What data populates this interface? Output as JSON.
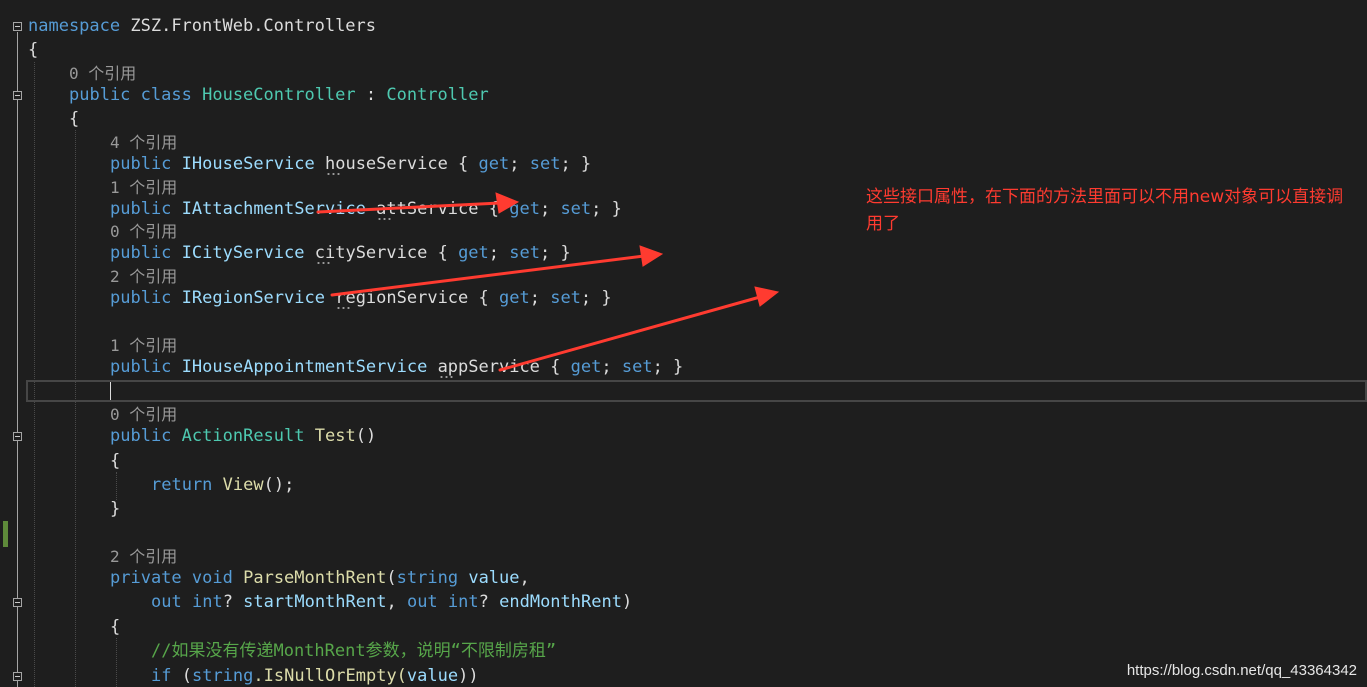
{
  "code": {
    "namespace_kw": "namespace",
    "namespace_name": "ZSZ.FrontWeb.Controllers",
    "open_brace": "{",
    "refs_0_class": "0 个引用",
    "class_public": "public",
    "class_kw": "class",
    "class_name": "HouseController",
    "class_colon": " : ",
    "class_base": "Controller",
    "class_open": "{",
    "props": [
      {
        "ref": "4 个引用",
        "public": "public",
        "type": "IHouseService",
        "name": "houseService",
        "tail_open": " { ",
        "get": "get",
        "semi1": "; ",
        "set": "set",
        "tail_close": "; }"
      },
      {
        "ref": "1 个引用",
        "public": "public",
        "type": "IAttachmentService",
        "name": "attService",
        "tail_open": " { ",
        "get": "get",
        "semi1": "; ",
        "set": "set",
        "tail_close": "; }"
      },
      {
        "ref": "0 个引用",
        "public": "public",
        "type": "ICityService",
        "name": "cityService",
        "tail_open": " { ",
        "get": "get",
        "semi1": "; ",
        "set": "set",
        "tail_close": "; }"
      },
      {
        "ref": "2 个引用",
        "public": "public",
        "type": "IRegionService",
        "name": "regionService",
        "tail_open": " { ",
        "get": "get",
        "semi1": "; ",
        "set": "set",
        "tail_close": "; }"
      },
      {
        "ref": "1 个引用",
        "public": "public",
        "type": "IHouseAppointmentService",
        "name": "appService",
        "tail_open": " { ",
        "get": "get",
        "semi1": "; ",
        "set": "set",
        "tail_close": "; }"
      }
    ],
    "test_ref": "0 个引用",
    "test_public": "public",
    "test_type": "ActionResult",
    "test_name": "Test",
    "test_parens": "()",
    "test_open": "{",
    "test_return": "return",
    "test_view": "View",
    "test_view_tail": "();",
    "test_close": "}",
    "parse_ref": "2 个引用",
    "parse_private": "private",
    "parse_void": "void",
    "parse_name": "ParseMonthRent",
    "parse_paren": "(",
    "parse_string": "string",
    "parse_value": "value",
    "parse_comma": ",",
    "parse_out1": "out",
    "parse_int1": "int",
    "parse_q1": "? ",
    "parse_start": "startMonthRent",
    "parse_comma2": ", ",
    "parse_out2": "out",
    "parse_int2": "int",
    "parse_q2": "? ",
    "parse_end": "endMonthRent",
    "parse_close_paren": ")",
    "parse_open": "{",
    "comment": "//如果没有传递MonthRent参数，说明“不限制房租”",
    "if_kw": "if",
    "if_open": " (",
    "if_string": "string",
    "if_call": ".IsNullOrEmpty(",
    "if_value": "value",
    "if_close": "))"
  },
  "annotation": {
    "text": "这些接口属性，在下面的方法里面可以不用new对象可以直接调用了",
    "color": "#ff3b30"
  },
  "watermark": "https://blog.csdn.net/qq_43364342",
  "colors": {
    "background": "#1e1e1e",
    "keyword": "#569cd6",
    "type": "#4ec9b0",
    "method": "#dcdcaa",
    "comment": "#57a64a",
    "arrow": "#ff3b30"
  }
}
